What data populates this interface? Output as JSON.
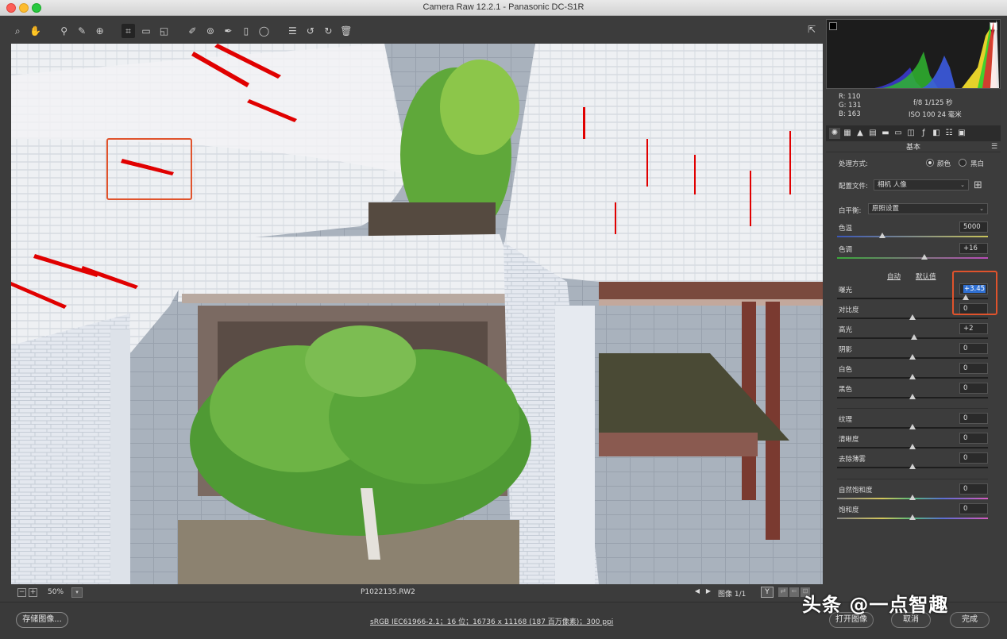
{
  "window": {
    "title": "Camera Raw 12.2.1 -  Panasonic DC-S1R"
  },
  "toolbar": {
    "tools": [
      "zoom-icon",
      "hand-icon",
      "white-balance-icon",
      "color-sampler-icon",
      "target-adjust-icon",
      "crop-icon",
      "straighten-icon",
      "transform-icon",
      "spot-removal-icon",
      "red-eye-icon",
      "brush-icon",
      "graduated-filter-icon",
      "radial-filter-icon",
      "list-icon",
      "rotate-left-icon",
      "rotate-right-icon",
      "trash-icon"
    ]
  },
  "bottom": {
    "zoom": "50%",
    "filename": "P1022135.RW2",
    "image_count": "图像 1/1",
    "y_label": "Y"
  },
  "footer": {
    "save": "存储图像...",
    "workflow": "sRGB IEC61966-2.1；16 位；16736 x 11168 (187 百万像素)；300 ppi",
    "open": "打开图像",
    "cancel": "取消",
    "done": "完成",
    "watermark": "头条 @一点智趣"
  },
  "info": {
    "r": "R:   110",
    "g": "G:   131",
    "b": "B:   163",
    "aperture_shutter": "f/8   1/125 秒",
    "iso_focal": "ISO 100   24 毫米"
  },
  "panel": {
    "title": "基本",
    "treatment_label": "处理方式:",
    "color": "颜色",
    "bw": "黑白",
    "profile_label": "配置文件:",
    "profile_value": "相机 人像",
    "wb_label": "白平衡:",
    "wb_value": "原照设置",
    "auto": "自动",
    "default": "默认值",
    "sliders": [
      {
        "label": "色温",
        "value": "5000",
        "pos": 0.3
      },
      {
        "label": "色调",
        "value": "+16",
        "pos": 0.58
      },
      {
        "label": "曝光",
        "value": "+3.45",
        "pos": 0.85
      },
      {
        "label": "对比度",
        "value": "0",
        "pos": 0.5
      },
      {
        "label": "高光",
        "value": "+2",
        "pos": 0.51
      },
      {
        "label": "阴影",
        "value": "0",
        "pos": 0.5
      },
      {
        "label": "白色",
        "value": "0",
        "pos": 0.5
      },
      {
        "label": "黑色",
        "value": "0",
        "pos": 0.5
      },
      {
        "label": "纹理",
        "value": "0",
        "pos": 0.5
      },
      {
        "label": "清晰度",
        "value": "0",
        "pos": 0.5
      },
      {
        "label": "去除薄雾",
        "value": "0",
        "pos": 0.5
      },
      {
        "label": "自然饱和度",
        "value": "0",
        "pos": 0.5
      },
      {
        "label": "饱和度",
        "value": "0",
        "pos": 0.5
      }
    ]
  },
  "colors": {
    "accent": "#2f6fd1",
    "highlight_box": "#e0532c",
    "clipping": "#e00000"
  }
}
